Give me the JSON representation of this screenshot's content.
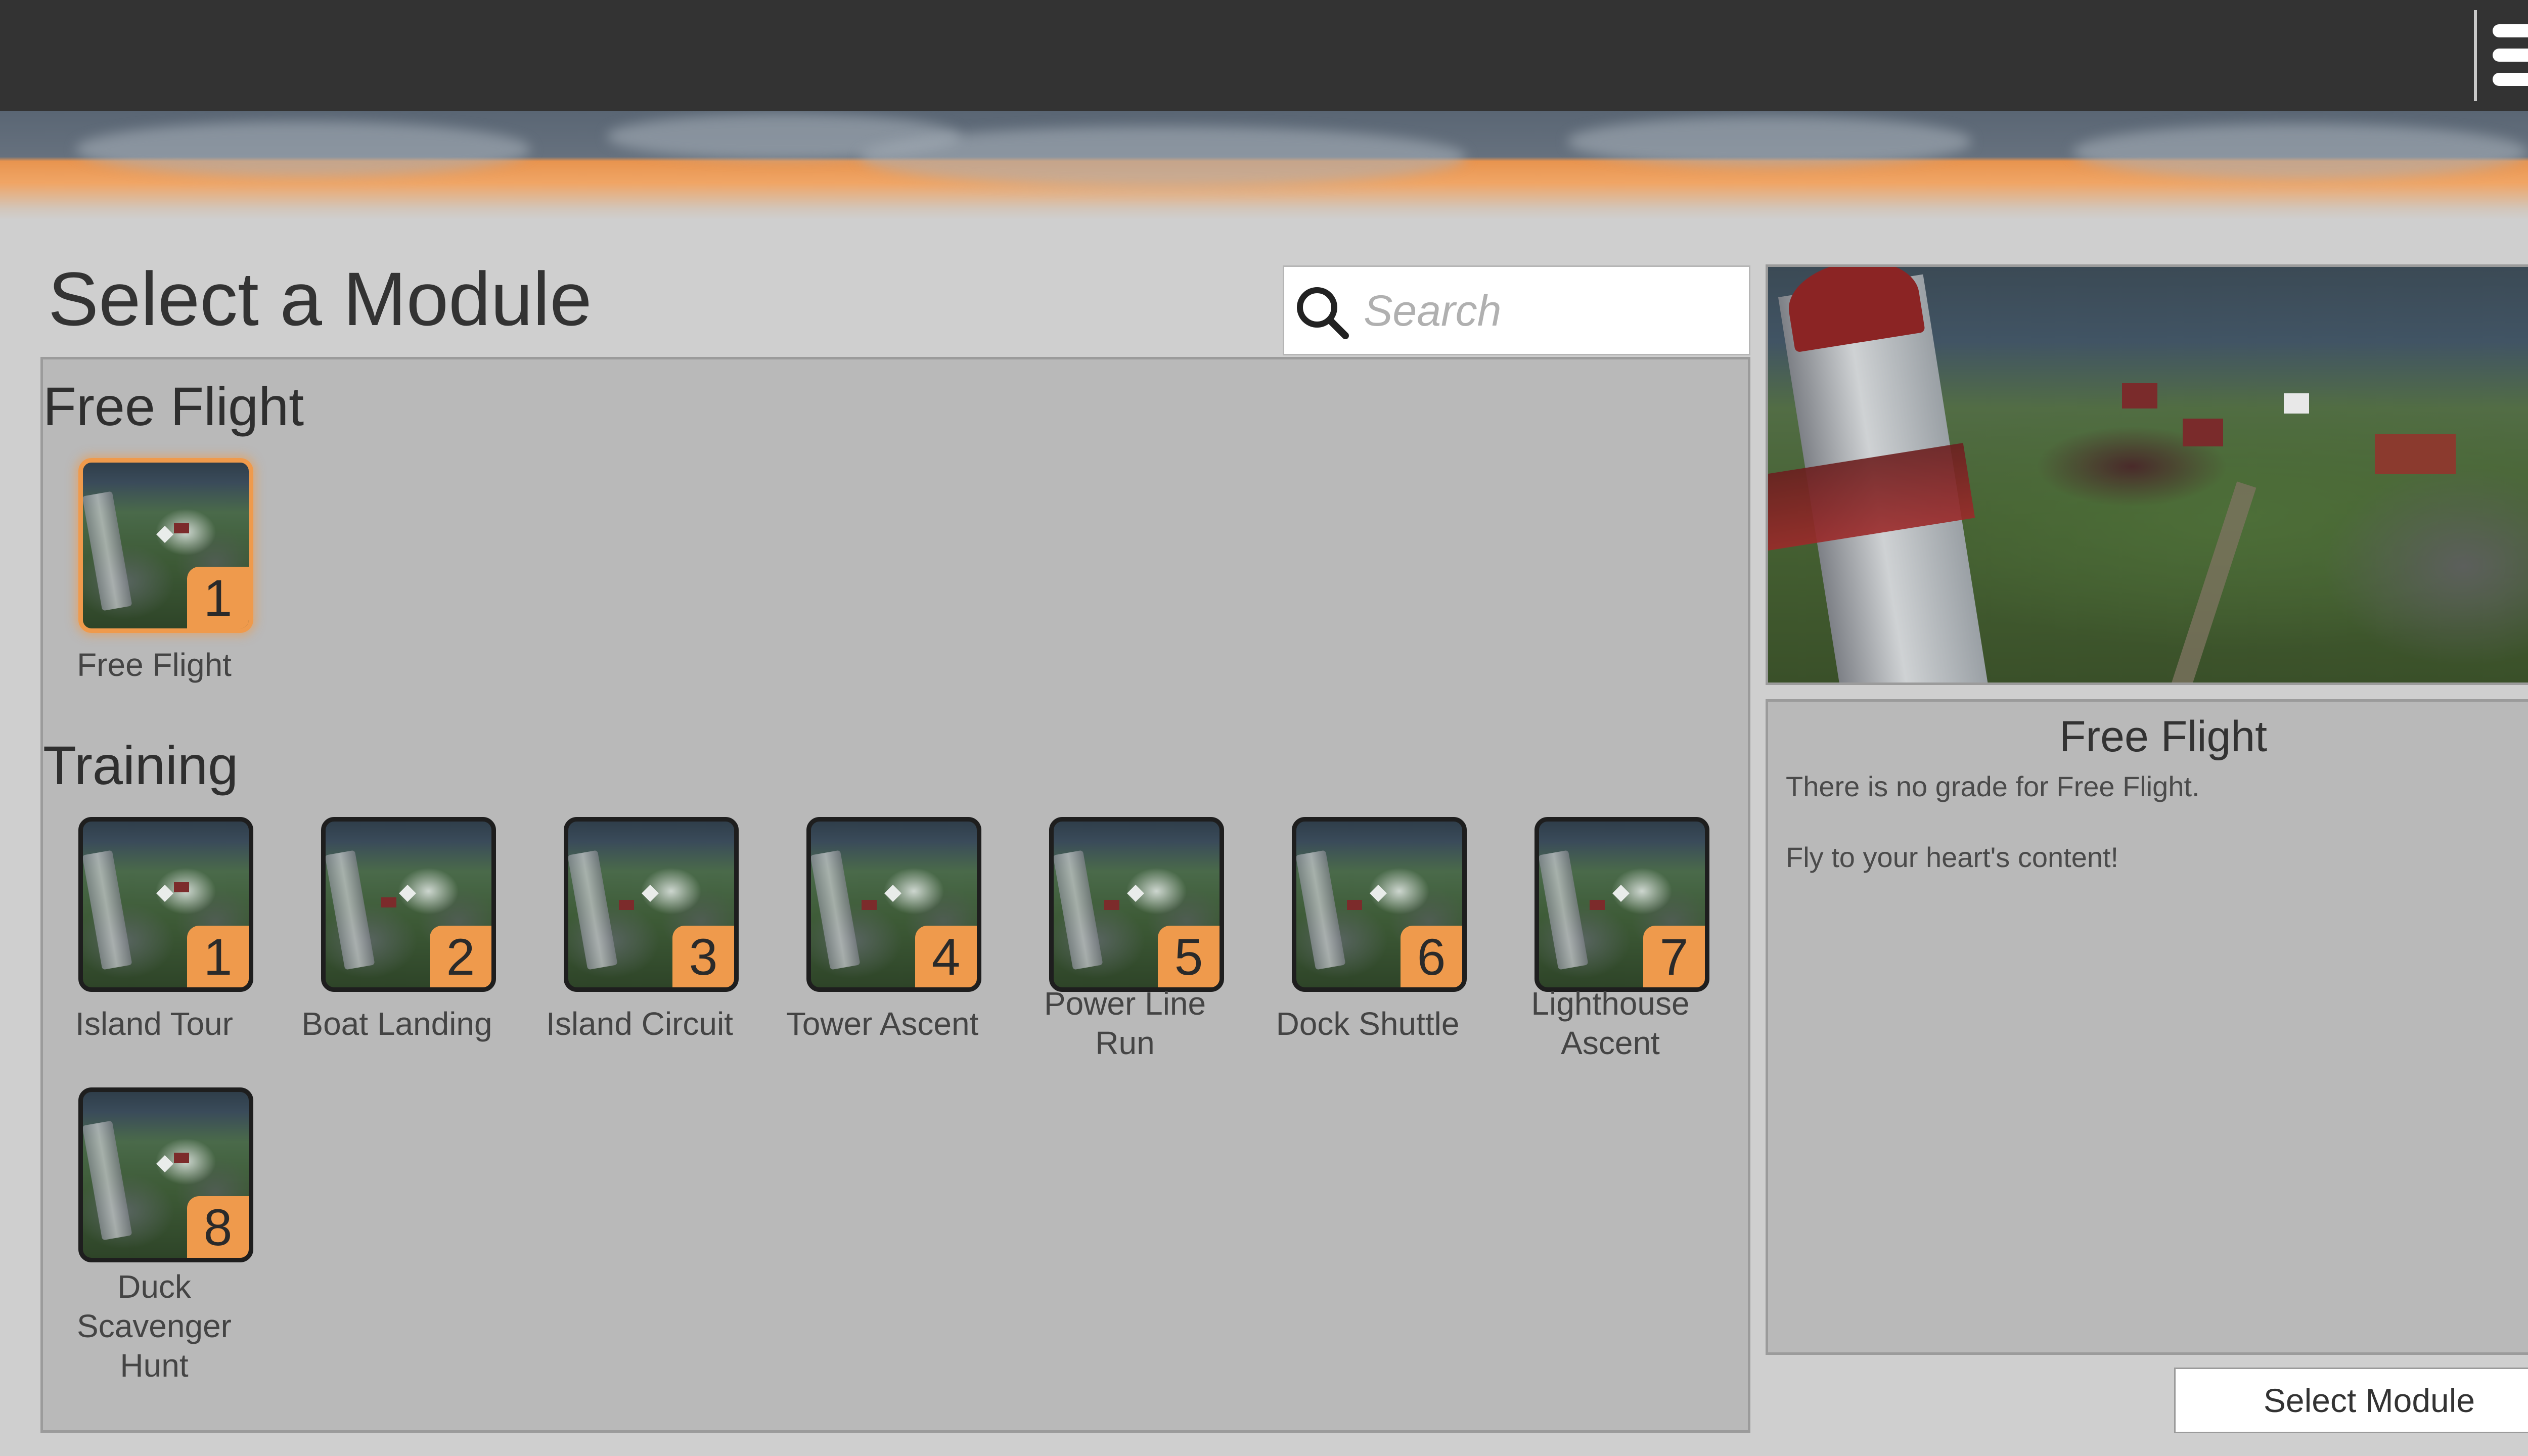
{
  "header": {
    "menu_icon": "hamburger-menu-icon"
  },
  "page": {
    "title": "Select a Module"
  },
  "search": {
    "placeholder": "Search",
    "value": "",
    "icon": "search-icon"
  },
  "sections": [
    {
      "title": "Free Flight",
      "modules": [
        {
          "number": "1",
          "label": "Free Flight",
          "selected": true
        }
      ]
    },
    {
      "title": "Training",
      "modules": [
        {
          "number": "1",
          "label": "Island Tour"
        },
        {
          "number": "2",
          "label": "Boat Landing"
        },
        {
          "number": "3",
          "label": "Island Circuit"
        },
        {
          "number": "4",
          "label": "Tower Ascent"
        },
        {
          "number": "5",
          "label": "Power Line Run"
        },
        {
          "number": "6",
          "label": "Dock Shuttle"
        },
        {
          "number": "7",
          "label": "Lighthouse Ascent"
        },
        {
          "number": "8",
          "label": "Duck Scavenger Hunt"
        }
      ]
    }
  ],
  "details": {
    "title": "Free Flight",
    "line1": "There is no grade for Free Flight.",
    "line2": "Fly to your heart's content!"
  },
  "actions": {
    "select_label": "Select Module"
  },
  "colors": {
    "topbar": "#333333",
    "accent": "#ef9a4c",
    "panel": "#b9b9b9",
    "background": "#cfcfcf"
  }
}
